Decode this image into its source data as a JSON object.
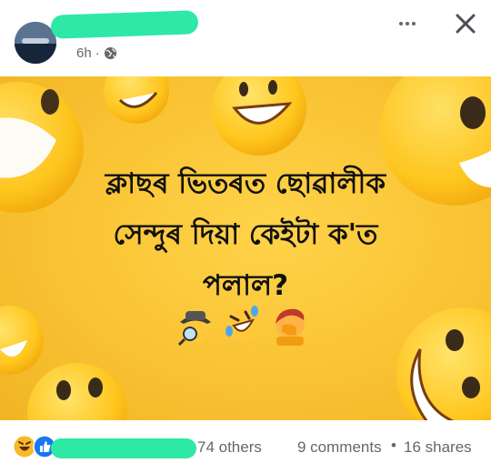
{
  "post": {
    "time": "6h",
    "separator": "·",
    "privacy_icon": "globe-icon",
    "more_icon": "more-horizontal-icon",
    "close_icon": "close-icon"
  },
  "image": {
    "text_lines": [
      "ক্লাছৰ ভিতৰত ছোৱালীক",
      "সেন্দুৰ দিয়া কেইটা ক'ত",
      "পলাল?"
    ],
    "emojis": [
      "detective-emoji",
      "rolling-laughing-emoji",
      "facepalm-emoji"
    ],
    "background_color": "#f9c333"
  },
  "footer": {
    "reactions": [
      "laughing-reaction-icon",
      "like-reaction-icon"
    ],
    "others_text": "74 others",
    "comments_text": "9 comments",
    "separator": "•",
    "shares_text": "16 shares"
  },
  "colors": {
    "redaction": "#2ee8a6",
    "muted_text": "#65676b",
    "like_blue": "#1877f2"
  }
}
